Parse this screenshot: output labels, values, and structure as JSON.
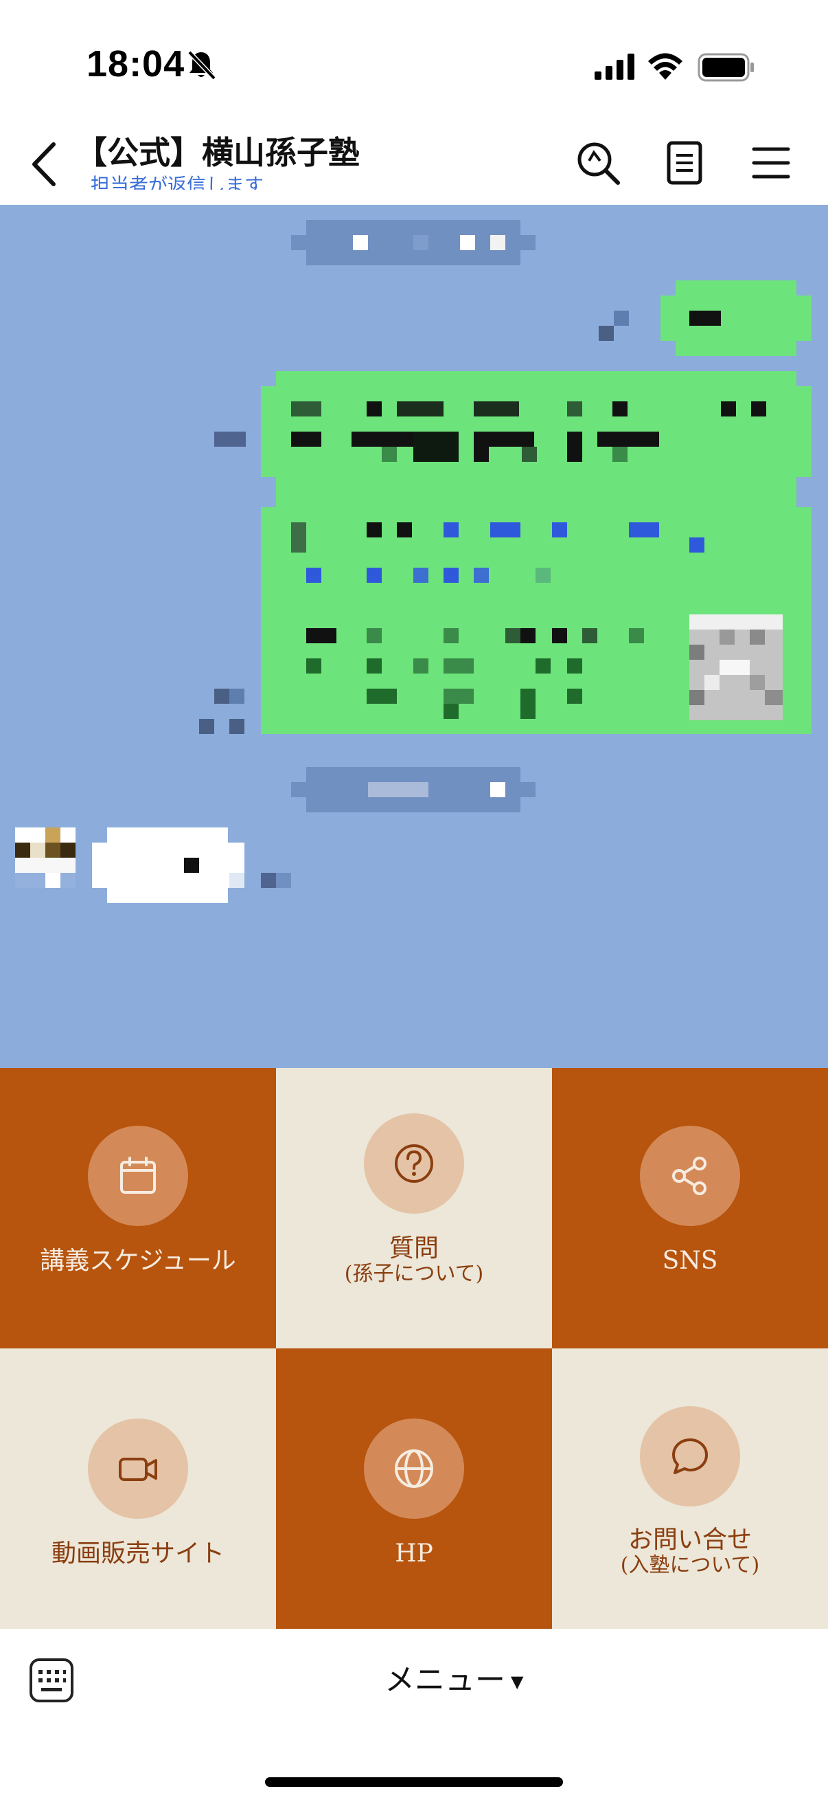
{
  "status_bar": {
    "time": "18:04",
    "icons": [
      "bell-slash-icon",
      "cellular-signal-icon",
      "wifi-icon",
      "battery-icon"
    ]
  },
  "header": {
    "title": "【公式】横山孫子塾",
    "subtitle": "担当者が返信します",
    "icons": [
      "back-icon",
      "search-icon",
      "notes-icon",
      "menu-icon"
    ]
  },
  "rich_menu": {
    "items": [
      {
        "icon": "calendar-icon",
        "label": "講義スケジュール",
        "sub": ""
      },
      {
        "icon": "question-icon",
        "label": "質問",
        "sub": "(孫子について)"
      },
      {
        "icon": "share-icon",
        "label": "SNS",
        "sub": ""
      },
      {
        "icon": "video-icon",
        "label": "動画販売サイト",
        "sub": ""
      },
      {
        "icon": "globe-icon",
        "label": "HP",
        "sub": ""
      },
      {
        "icon": "chat-bubble-icon",
        "label": "お問い合せ",
        "sub": "(入塾について)"
      }
    ]
  },
  "bottom_bar": {
    "menu_label": "メニュー",
    "menu_arrow": "▼",
    "icons": [
      "keyboard-icon"
    ]
  },
  "colors": {
    "chat_background": "#8caddb",
    "own_bubble": "#6de37b",
    "menu_orange": "#b7540d",
    "menu_cream": "#ece7d8",
    "subtitle_blue": "#3b6fd8"
  }
}
